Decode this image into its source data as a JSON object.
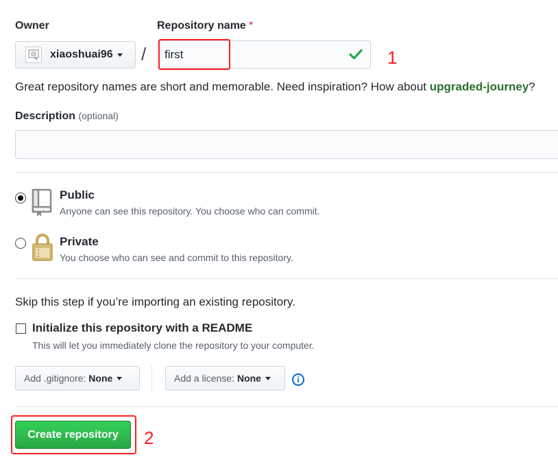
{
  "owner": {
    "label": "Owner",
    "value": "xiaoshuai96"
  },
  "repo_name": {
    "label": "Repository name",
    "required_mark": "*",
    "value": "first"
  },
  "hint": {
    "text": "Great repository names are short and memorable. Need inspiration? How about ",
    "suggestion": "upgraded-journey",
    "suffix": "?"
  },
  "description": {
    "label": "Description",
    "optional": "(optional)",
    "value": ""
  },
  "visibility": {
    "selected": "Public",
    "options": [
      {
        "title": "Public",
        "note": "Anyone can see this repository. You choose who can commit."
      },
      {
        "title": "Private",
        "note": "You choose who can see and commit to this repository."
      }
    ]
  },
  "init": {
    "skip_text": "Skip this step if you’re importing an existing repository.",
    "readme_label": "Initialize this repository with a README",
    "readme_note": "This will let you immediately clone the repository to your computer.",
    "readme_checked": false
  },
  "gitignore": {
    "label": "Add .gitignore:",
    "value": "None"
  },
  "license": {
    "label": "Add a license:",
    "value": "None"
  },
  "create_button": "Create repository",
  "annotations": {
    "step1": "1",
    "step2": "2",
    "color": "#ff1f1f"
  },
  "colors": {
    "accent_green": "#28a745",
    "link_blue": "#0366d6",
    "required_red": "#cb2431"
  }
}
